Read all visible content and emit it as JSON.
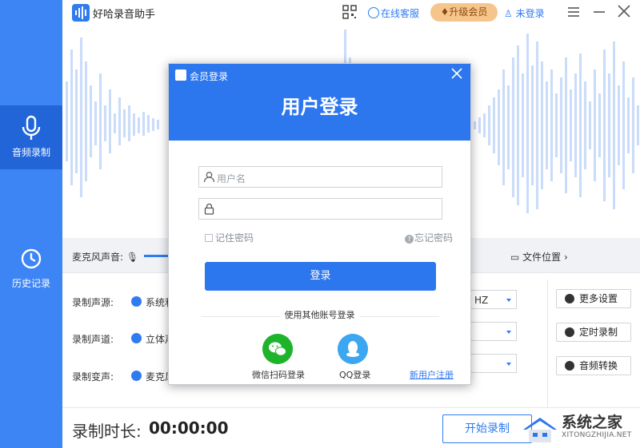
{
  "app": {
    "title": "好哈录音助手"
  },
  "titlebar": {
    "service_label": "在线客服",
    "vip_label": "升级会员",
    "login_label": "未登录"
  },
  "sidebar": {
    "items": [
      {
        "label": "音频录制",
        "icon": "mic-icon",
        "active": true
      },
      {
        "label": "历史记录",
        "icon": "clock-icon",
        "active": false
      }
    ]
  },
  "mic": {
    "label": "麦克风声音:",
    "file_location": "文件位置"
  },
  "settings": {
    "rows": [
      {
        "label": "录制声源:",
        "value": "系统和"
      },
      {
        "label": "录制声道:",
        "value": "立体声"
      },
      {
        "label": "录制变声:",
        "value": "麦克风"
      }
    ],
    "selects": [
      "HZ",
      "",
      ""
    ],
    "side_buttons": [
      "更多设置",
      "定时录制",
      "音频转换"
    ]
  },
  "bottom": {
    "duration_label": "录制时长:",
    "duration_value": "00:00:00",
    "start_label": "开始录制"
  },
  "watermark": {
    "title": "系统之家",
    "subtitle": "XITONGZHIJIA.NET"
  },
  "modal": {
    "title": "会员登录",
    "heading": "用户登录",
    "username_placeholder": "用户名",
    "password_placeholder": "",
    "remember_label": "记住密码",
    "forgot_label": "忘记密码",
    "login_button": "登录",
    "other_login_label": "使用其他账号登录",
    "wechat_label": "微信扫码登录",
    "qq_label": "QQ登录",
    "register_label": "新用户注册"
  },
  "colors": {
    "accent": "#2f7bf0",
    "sidebar": "#3d84f5",
    "sidebar_active": "#2165d8",
    "vip": "#f6c58c",
    "wechat": "#1db42c",
    "qq": "#3ca6f0"
  }
}
